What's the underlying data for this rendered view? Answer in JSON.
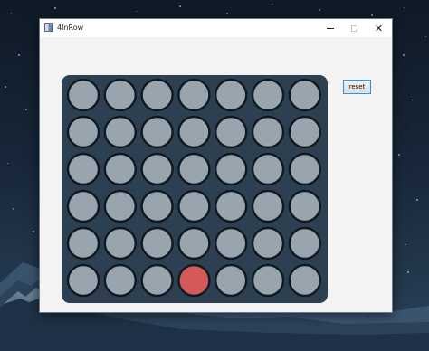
{
  "window": {
    "title": "4InRow",
    "icon": "app-window-icon",
    "controls": {
      "minimize": "minimize-icon",
      "maximize": "maximize-icon",
      "close_glyph": "✕"
    }
  },
  "toolbar": {
    "reset_label": "reset"
  },
  "board": {
    "columns": 7,
    "rows": 6,
    "empty_color": "#98a5ae",
    "red_color": "#d45a5a",
    "cell_border_color": "#101820",
    "background_color": "#2d4052",
    "cells": [
      [
        "empty",
        "empty",
        "empty",
        "empty",
        "empty",
        "empty",
        "empty"
      ],
      [
        "empty",
        "empty",
        "empty",
        "empty",
        "empty",
        "empty",
        "empty"
      ],
      [
        "empty",
        "empty",
        "empty",
        "empty",
        "empty",
        "empty",
        "empty"
      ],
      [
        "empty",
        "empty",
        "empty",
        "empty",
        "empty",
        "empty",
        "empty"
      ],
      [
        "empty",
        "empty",
        "empty",
        "empty",
        "empty",
        "empty",
        "empty"
      ],
      [
        "empty",
        "empty",
        "empty",
        "red",
        "empty",
        "empty",
        "empty"
      ]
    ]
  }
}
